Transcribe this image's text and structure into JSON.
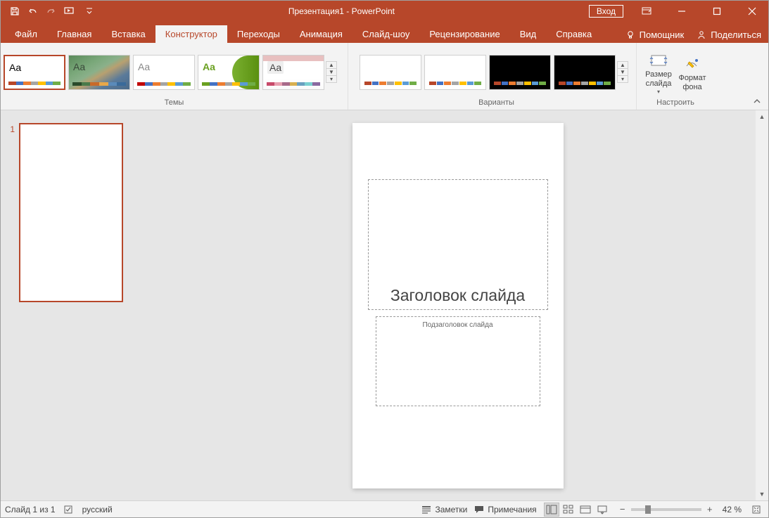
{
  "titlebar": {
    "title": "Презентация1 - PowerPoint",
    "signin": "Вход"
  },
  "tabs": {
    "file": "Файл",
    "home": "Главная",
    "insert": "Вставка",
    "design": "Конструктор",
    "transitions": "Переходы",
    "animations": "Анимация",
    "slideshow": "Слайд-шоу",
    "review": "Рецензирование",
    "view": "Вид",
    "help": "Справка",
    "assistant": "Помощник",
    "share": "Поделиться"
  },
  "ribbon": {
    "themes_label": "Темы",
    "variants_label": "Варианты",
    "customize_label": "Настроить",
    "theme_aa": "Aa",
    "slide_size": "Размер слайда",
    "format_bg": "Формат фона",
    "slide_size_drop": "▾"
  },
  "thumbnails": {
    "num1": "1"
  },
  "slide": {
    "title_placeholder": "Заголовок слайда",
    "subtitle_placeholder": "Подзаголовок слайда"
  },
  "statusbar": {
    "slide_info": "Слайд 1 из 1",
    "language": "русский",
    "notes": "Заметки",
    "comments": "Примечания",
    "zoom": "42 %"
  },
  "colors": {
    "accent": "#b7472a"
  }
}
